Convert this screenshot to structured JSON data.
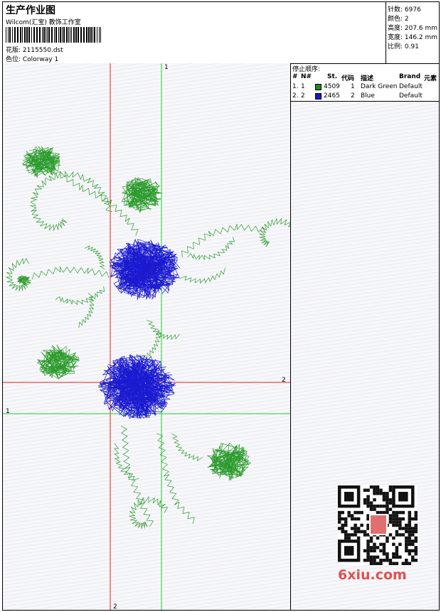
{
  "header": {
    "title": "生产作业图",
    "company": "Wilcom(汇宝) 教饰工作室",
    "design_label": "花版: 2115550.dst",
    "colorway_label": "色位: Colorway 1"
  },
  "stats": {
    "stitches": "针数: 6976",
    "colors": "颜色: 2",
    "height": "高度: 207.6 mm",
    "width": "宽度: 146.2 mm",
    "scale": "比例: 0.91"
  },
  "canvas": {
    "axis_v1": "1",
    "axis_h2": "2",
    "axis_h1": "1",
    "axis_v2": "2",
    "colors": {
      "red_guide": "#e02020",
      "green_guide": "#22cc22",
      "leaf": "#2a9a2a",
      "flower": "#1a1ad0"
    }
  },
  "panel": {
    "stop_sequence_title": "停止顺序:",
    "columns": [
      "#",
      "N#",
      "St.",
      "代码",
      "描述",
      "Brand",
      "元素"
    ],
    "rows": [
      {
        "index": "1.",
        "n": "1",
        "color": "#1e8a1e",
        "stitches": "4509",
        "code": "1",
        "description": "Dark Green",
        "brand": "Default"
      },
      {
        "index": "2.",
        "n": "2",
        "color": "#1414d8",
        "stitches": "2465",
        "code": "2",
        "description": "Blue",
        "brand": "Default"
      }
    ],
    "watermark": "6xiu.com",
    "qr_badge": "秀 网 图 库"
  }
}
